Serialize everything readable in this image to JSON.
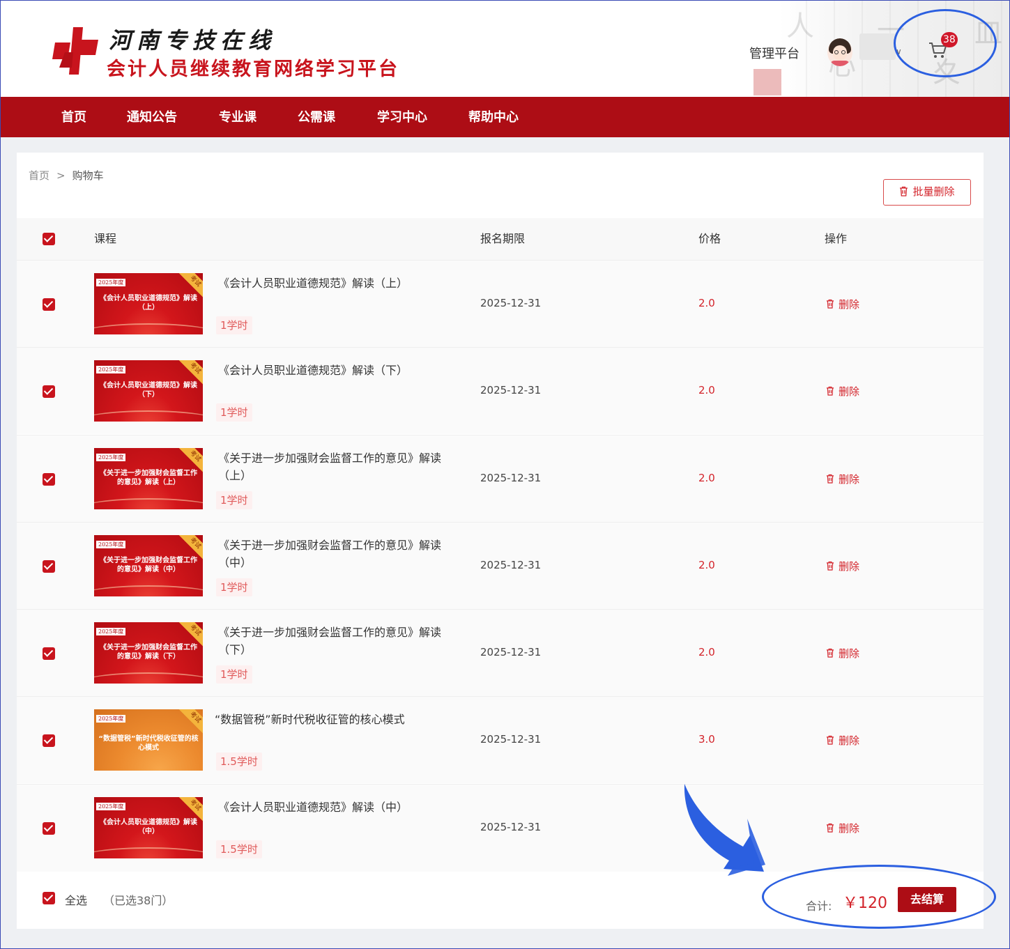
{
  "header": {
    "logo_line1": "河南专技在线",
    "logo_line2": "会计人员继续教育网络学习平台",
    "mgmt_label": "管理平台",
    "cart_count": "38",
    "caret": "∨"
  },
  "nav": {
    "items": [
      "首页",
      "通知公告",
      "专业课",
      "公需课",
      "学习中心",
      "帮助中心"
    ]
  },
  "breadcrumb": {
    "home": "首页",
    "sep": ">",
    "current": "购物车"
  },
  "toolbar": {
    "batch_delete_label": "批量删除"
  },
  "table": {
    "headers": {
      "course": "课程",
      "deadline": "报名期限",
      "price": "价格",
      "action": "操作"
    },
    "rows": [
      {
        "thumb_year": "2025年度",
        "thumb_tag": "考试",
        "thumb_title": "《会计人员职业道德规范》解读（上）",
        "name": "《会计人员职业道德规范》解读（上）",
        "hours": "1学时",
        "deadline": "2025-12-31",
        "price": "2.0",
        "delete": "删除"
      },
      {
        "thumb_year": "2025年度",
        "thumb_tag": "考试",
        "thumb_title": "《会计人员职业道德规范》解读（下）",
        "name": "《会计人员职业道德规范》解读（下）",
        "hours": "1学时",
        "deadline": "2025-12-31",
        "price": "2.0",
        "delete": "删除"
      },
      {
        "thumb_year": "2025年度",
        "thumb_tag": "考试",
        "thumb_title": "《关于进一步加强财会监督工作的意见》解读（上）",
        "name": "《关于进一步加强财会监督工作的意见》解读（上）",
        "hours": "1学时",
        "deadline": "2025-12-31",
        "price": "2.0",
        "delete": "删除"
      },
      {
        "thumb_year": "2025年度",
        "thumb_tag": "考试",
        "thumb_title": "《关于进一步加强财会监督工作的意见》解读（中）",
        "name": "《关于进一步加强财会监督工作的意见》解读（中）",
        "hours": "1学时",
        "deadline": "2025-12-31",
        "price": "2.0",
        "delete": "删除"
      },
      {
        "thumb_year": "2025年度",
        "thumb_tag": "考试",
        "thumb_title": "《关于进一步加强财会监督工作的意见》解读（下）",
        "name": "《关于进一步加强财会监督工作的意见》解读（下）",
        "hours": "1学时",
        "deadline": "2025-12-31",
        "price": "2.0",
        "delete": "删除"
      },
      {
        "thumb_year": "2025年度",
        "thumb_tag": "考试",
        "thumb_title": "“数据管税”新时代税收征管的核心模式",
        "name": "“数据管税”新时代税收征管的核心模式",
        "hours": "1.5学时",
        "deadline": "2025-12-31",
        "price": "3.0",
        "delete": "删除",
        "theme": "orange"
      },
      {
        "thumb_year": "2025年度",
        "thumb_tag": "考试",
        "thumb_title": "《会计人员职业道德规范》解读（中）",
        "name": "《会计人员职业道德规范》解读（中）",
        "hours": "1.5学时",
        "deadline": "2025-12-31",
        "price": "",
        "delete": "删除"
      }
    ]
  },
  "footer": {
    "select_all": "全选",
    "selected_count": "（已选38门）",
    "total_label": "合计:",
    "total_value": "￥120",
    "checkout_label": "去结算"
  },
  "colors": {
    "brand_red": "#ad0d15",
    "accent_red": "#d3232a",
    "annotation_blue": "#2b5fe0"
  }
}
